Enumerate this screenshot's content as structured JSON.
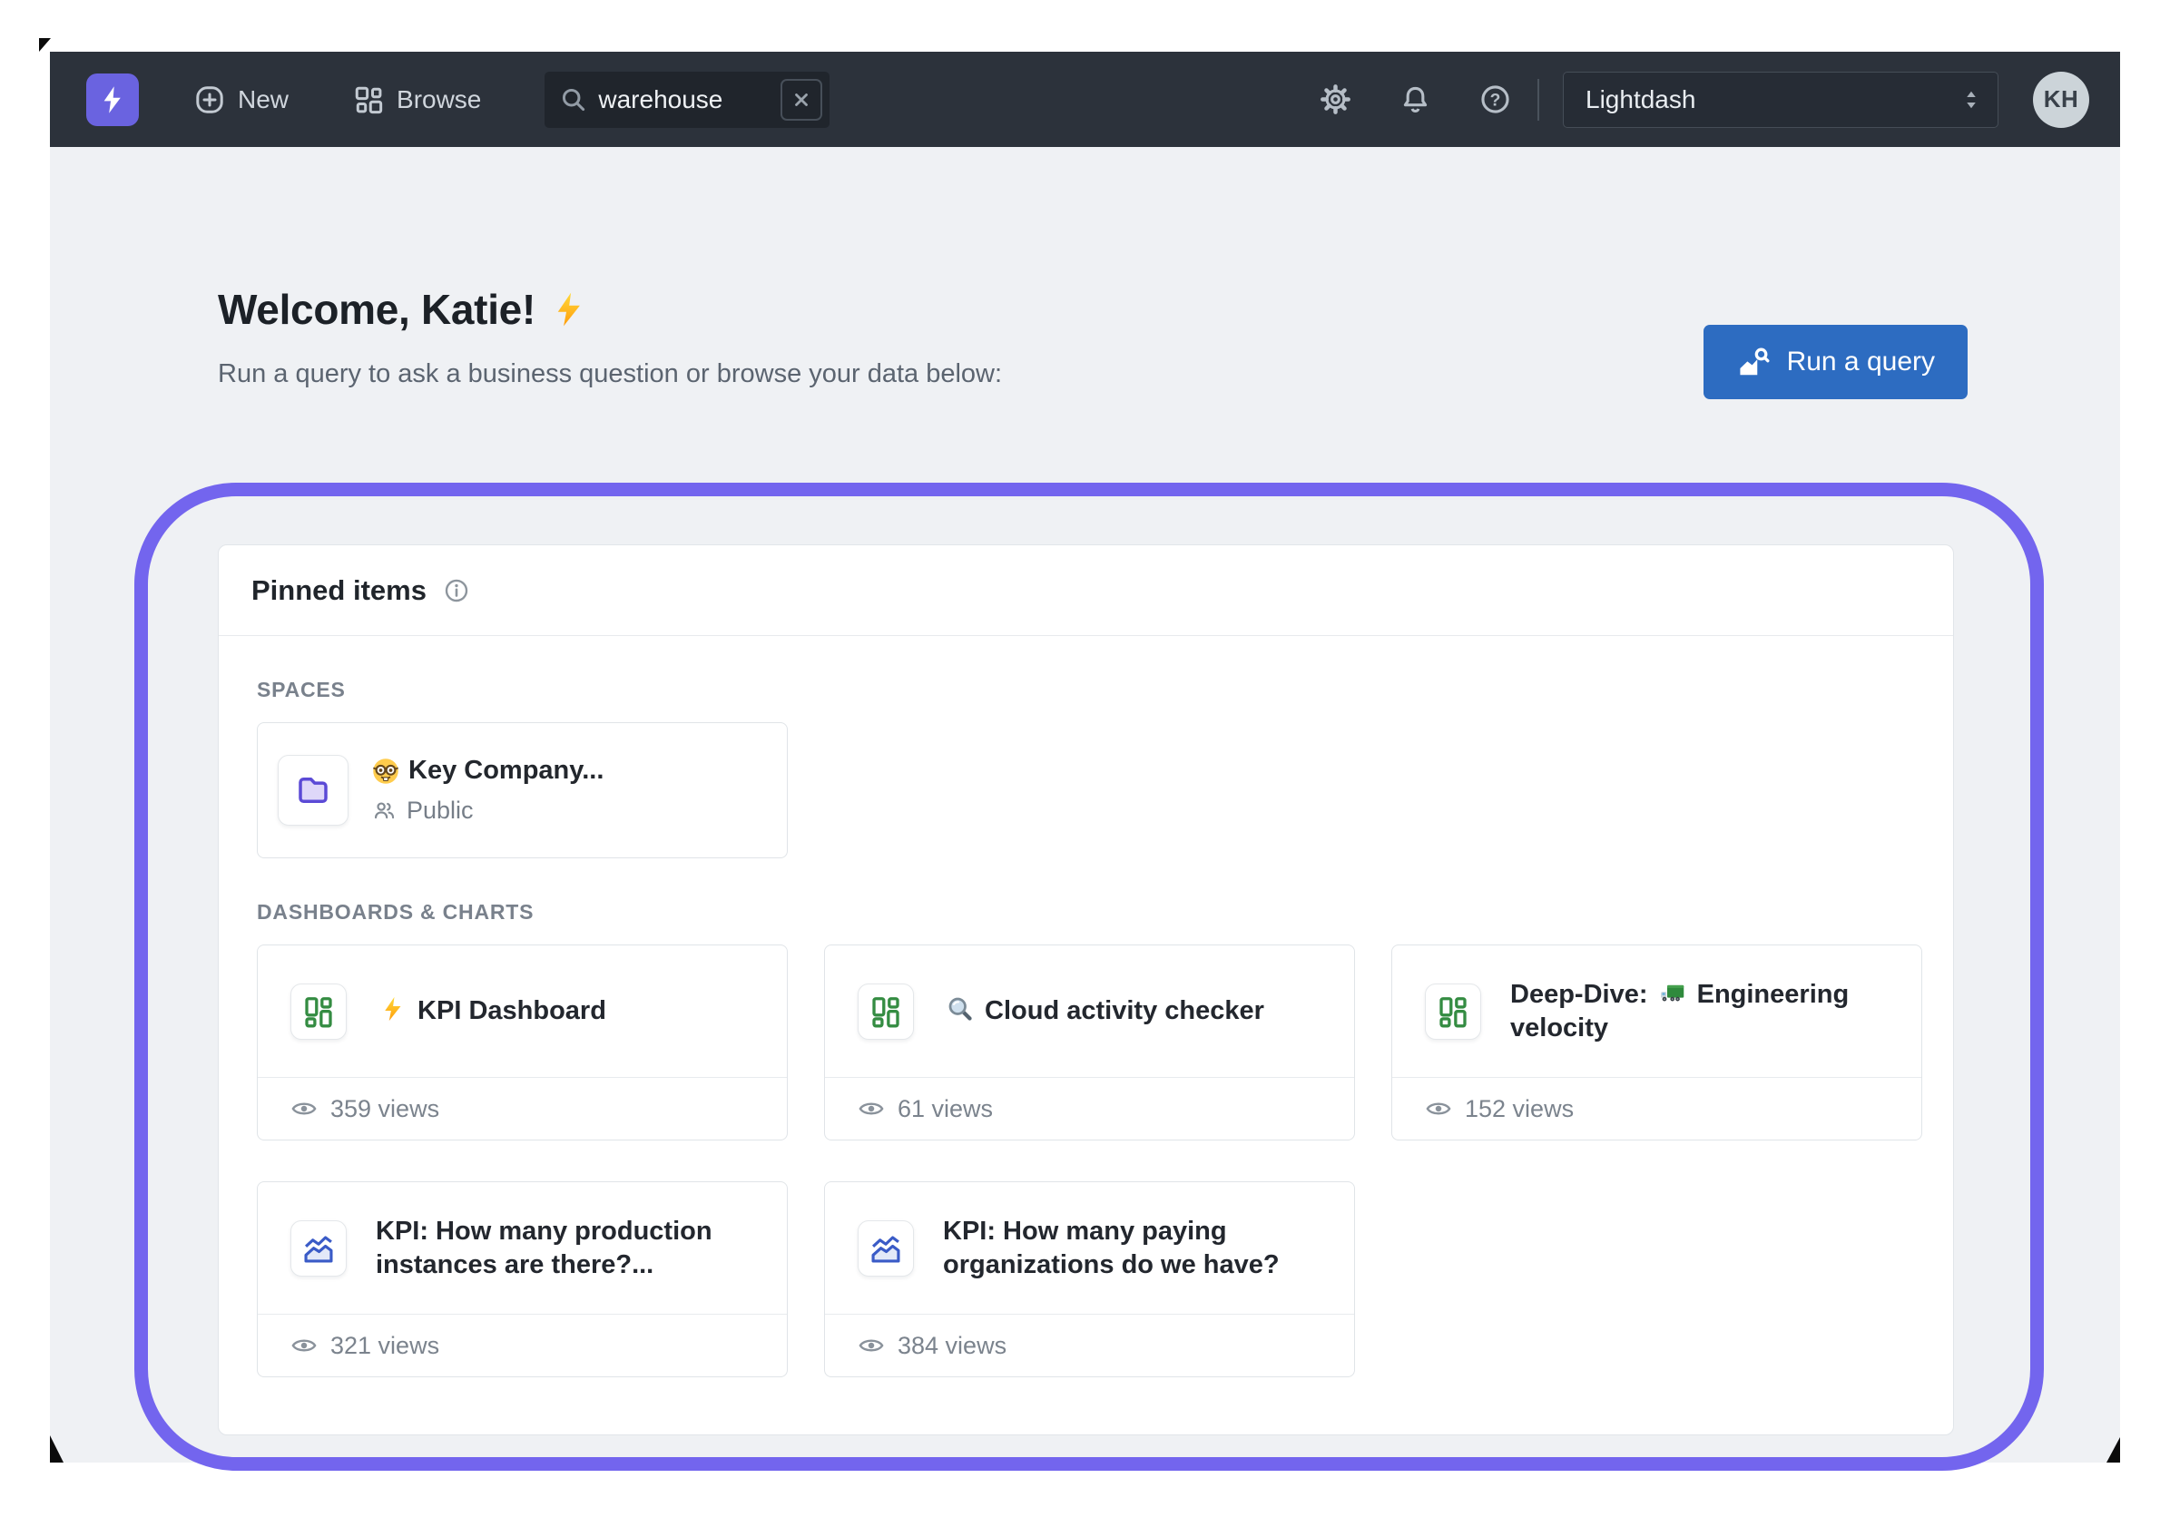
{
  "navbar": {
    "new_label": "New",
    "browse_label": "Browse",
    "search": {
      "value": "warehouse"
    },
    "project_selector": {
      "value": "Lightdash"
    },
    "avatar_initials": "KH"
  },
  "header": {
    "welcome_title": "Welcome, Katie!",
    "welcome_emoji": "⚡",
    "subtitle": "Run a query to ask a business question or browse your data below:",
    "run_query_label": "Run a query"
  },
  "pinned": {
    "title": "Pinned items",
    "spaces_label": "SPACES",
    "dashboards_charts_label": "DASHBOARDS & CHARTS",
    "spaces": [
      {
        "emoji": "🤓",
        "emoji_name": "nerd-face",
        "title": "Key Company...",
        "visibility": "Public"
      }
    ],
    "items": [
      {
        "type": "dashboard",
        "views": "359 views",
        "title_segments": [
          {
            "emoji": "⚡",
            "emoji_name": "zap"
          },
          {
            "text": " KPI Dashboard"
          }
        ]
      },
      {
        "type": "dashboard",
        "views": "61 views",
        "title_segments": [
          {
            "emoji": "🔎",
            "emoji_name": "magnifier"
          },
          {
            "text": " Cloud activity checker"
          }
        ]
      },
      {
        "type": "dashboard",
        "views": "152 views",
        "title_segments": [
          {
            "text": "Deep-Dive: "
          },
          {
            "emoji": "🚛",
            "emoji_name": "truck"
          },
          {
            "text": " Engineering velocity"
          }
        ]
      },
      {
        "type": "chart",
        "views": "321 views",
        "title_segments": [
          {
            "text": "KPI: How many production instances are there?..."
          }
        ]
      },
      {
        "type": "chart",
        "views": "384 views",
        "title_segments": [
          {
            "text": "KPI: How many paying organizations do we have?"
          }
        ]
      }
    ]
  },
  "colors": {
    "navbar_bg": "#2c323b",
    "page_bg": "#eff1f4",
    "accent_purple": "#7365ee",
    "logo_purple": "#6a63e0",
    "button_blue": "#2d6cc1",
    "dashboard_icon_green": "#348c42",
    "chart_icon_blue": "#3a5bc7"
  }
}
